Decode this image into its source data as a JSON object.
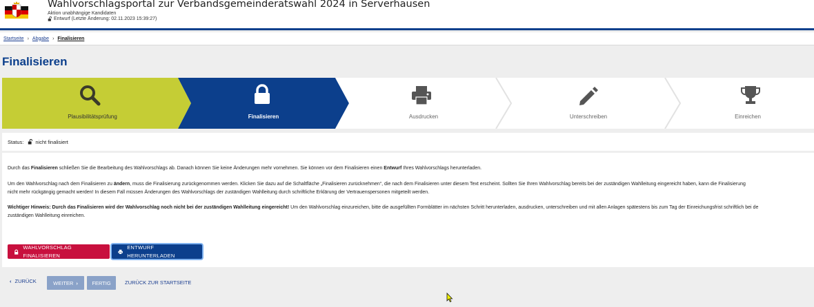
{
  "header": {
    "title": "Wahlvorschlagsportal zur Verbandsgemeinderatswahl 2024 in Serverhausen",
    "subtitle": "Aktion unabhängige Kandidaten",
    "draft_status": "Entwurf (Letzte Änderung: 02.11.2023 15:39:27)",
    "logo_icon": "coat-of-arms-icon"
  },
  "breadcrumb": {
    "items": [
      "Startseite",
      "Abgabe"
    ],
    "current": "Finalisieren"
  },
  "page_title": "Finalisieren",
  "stepper": {
    "steps": [
      {
        "label": "Plausibilitätsprüfung",
        "icon": "search-icon",
        "state": "done"
      },
      {
        "label": "Finalisieren",
        "icon": "lock-icon",
        "state": "active"
      },
      {
        "label": "Ausdrucken",
        "icon": "printer-icon",
        "state": "pending"
      },
      {
        "label": "Unterschreiben",
        "icon": "pencil-icon",
        "state": "pending"
      },
      {
        "label": "Einreichen",
        "icon": "trophy-icon",
        "state": "pending"
      }
    ],
    "colors": {
      "done": "#c5cd35",
      "active": "#0c3f8c",
      "pending": "#ffffff"
    }
  },
  "status": {
    "label": "Status:",
    "value": "nicht finalisiert"
  },
  "info": {
    "p1_a": "Durch das ",
    "p1_b": "Finalisieren",
    "p1_c": " schließen Sie die Bearbeitung des Wahlvorschlags ab. Danach können Sie keine Änderungen mehr vornehmen. Sie können vor dem Finalisieren einen ",
    "p1_d": "Entwurf",
    "p1_e": " Ihres Wahlvorschlags herunterladen.",
    "p2_a": "Um den Wahlvorschlag nach dem Finalisieren zu ",
    "p2_b": "ändern",
    "p2_c": ", muss die Finalisierung zurückgenommen werden. Klicken Sie dazu auf die Schaltfläche „Finalisieren zurücknehmen“, die nach dem Finalisieren unter diesem Text erscheint. Sollten Sie Ihren Wahlvorschlag bereits bei der zuständigen Wahlleitung eingereicht haben, kann die Finalisierung",
    "p2_d": "nicht mehr rückgängig gemacht werden! In diesem Fall müssen Änderungen des Wahlvorschlags der zuständigen Wahlleitung durch schriftliche Erklärung der Vertrauenspersonen mitgeteilt werden.",
    "p3_a": "Wichtiger Hinweis: Durch das Finalisieren wird der Wahlvorschlag noch nicht bei der zuständigen Wahlleitung eingereicht!",
    "p3_b": " Um den Wahlvorschlag einzureichen, bitte die ausgefüllten Formblätter im nächsten Schritt herunterladen, ausdrucken, unterschreiben und mit allen Anlagen spätestens bis zum Tag der Einreichungsfrist schriftlich bei de",
    "p3_c": "zuständigen Wahlleitung einreichen."
  },
  "buttons": {
    "finalize": "WAHLVORSCHLAG FINALISIEREN",
    "download": "ENTWURF HERUNTERLADEN"
  },
  "nav": {
    "back": "ZURÜCK",
    "next": "WEITER",
    "finish": "FERTIG",
    "home": "ZURÜCK ZUR STARTSEITE"
  }
}
